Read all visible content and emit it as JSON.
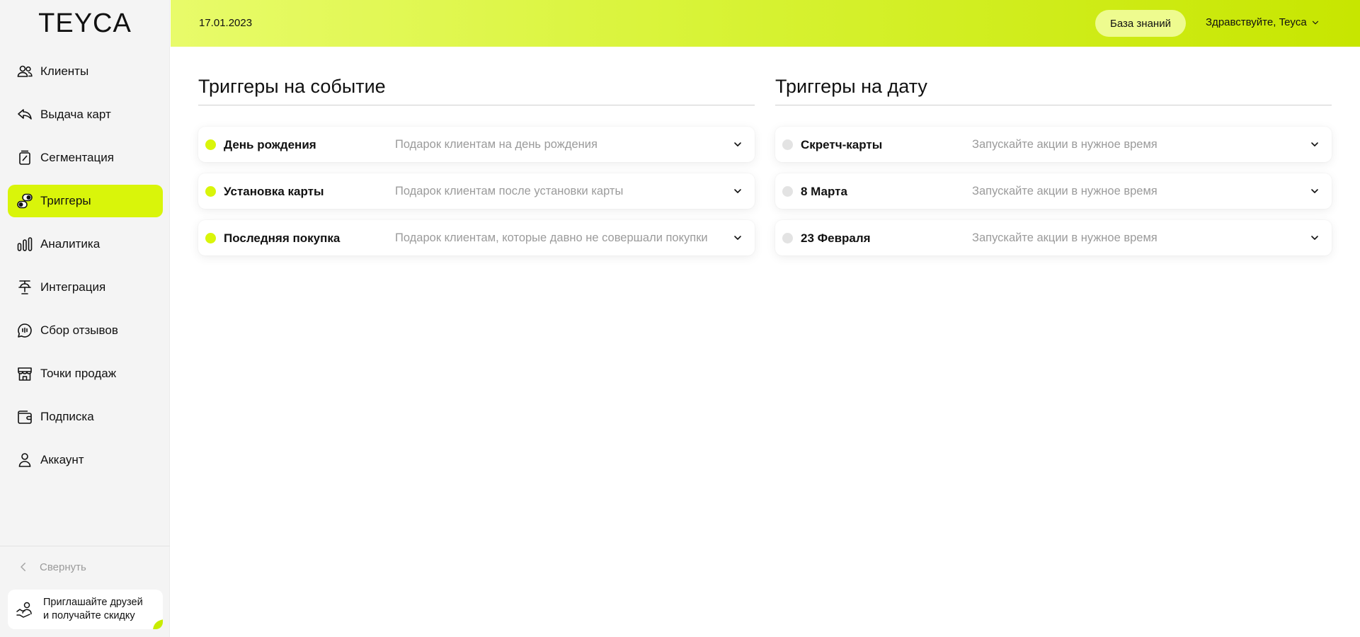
{
  "app": {
    "logo": "TEYCA"
  },
  "colors": {
    "accent": "#d9f50a",
    "active_dot": "#d9f50a",
    "inactive_dot": "#e3e3e3"
  },
  "sidebar": {
    "items": [
      {
        "label": "Клиенты",
        "icon": "users-icon",
        "active": false
      },
      {
        "label": "Выдача карт",
        "icon": "card-issue-icon",
        "active": false
      },
      {
        "label": "Сегментация",
        "icon": "segmentation-icon",
        "active": false
      },
      {
        "label": "Триггеры",
        "icon": "triggers-icon",
        "active": true
      },
      {
        "label": "Аналитика",
        "icon": "analytics-icon",
        "active": false
      },
      {
        "label": "Интеграция",
        "icon": "integration-icon",
        "active": false
      },
      {
        "label": "Сбор отзывов",
        "icon": "reviews-icon",
        "active": false
      },
      {
        "label": "Точки продаж",
        "icon": "store-icon",
        "active": false
      },
      {
        "label": "Подписка",
        "icon": "wallet-icon",
        "active": false
      },
      {
        "label": "Аккаунт",
        "icon": "account-icon",
        "active": false
      }
    ],
    "collapse_label": "Свернуть",
    "invite_line1": "Приглашайте друзей",
    "invite_line2": "и получайте скидку"
  },
  "header": {
    "date": "17.01.2023",
    "knowledge_base_label": "База знаний",
    "greeting": "Здравствуйте, Teyca"
  },
  "event_triggers": {
    "title": "Триггеры на событие",
    "items": [
      {
        "name": "День рождения",
        "description": "Подарок клиентам на день рождения",
        "active": true
      },
      {
        "name": "Установка карты",
        "description": "Подарок клиентам после установки карты",
        "active": true
      },
      {
        "name": "Последняя покупка",
        "description": "Подарок клиентам, которые давно не совершали покупки",
        "active": true
      }
    ]
  },
  "date_triggers": {
    "title": "Триггеры на дату",
    "items": [
      {
        "name": "Скретч-карты",
        "description": "Запускайте акции в нужное время",
        "active": false
      },
      {
        "name": "8 Марта",
        "description": "Запускайте акции в нужное время",
        "active": false
      },
      {
        "name": "23 Февраля",
        "description": "Запускайте акции в нужное время",
        "active": false
      }
    ]
  }
}
